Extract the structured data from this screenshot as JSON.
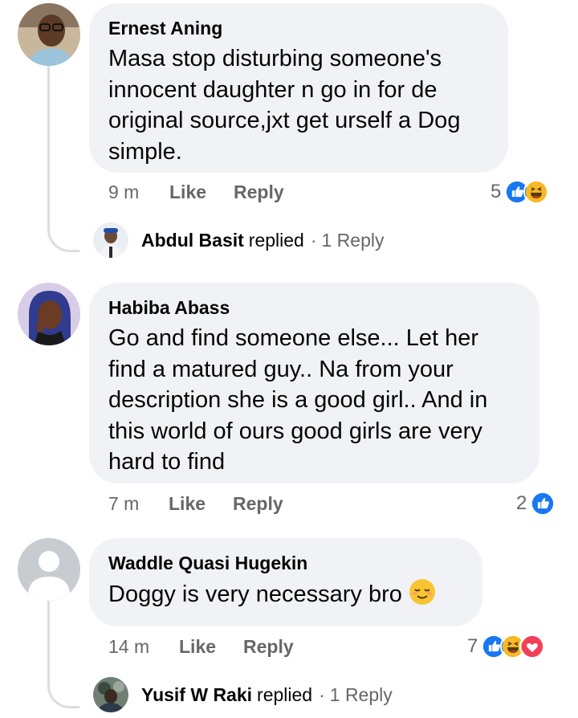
{
  "comments": [
    {
      "author": "Ernest Aning",
      "text": "Masa stop disturbing someone's innocent daughter n go in for de original source,jxt get urself a Dog simple.",
      "time": "9 m",
      "like_label": "Like",
      "reply_label": "Reply",
      "reaction_count": "5",
      "reactions": [
        "like-icon",
        "haha-icon"
      ],
      "replied": {
        "name": "Abdul Basit",
        "verb": "replied",
        "dot": "·",
        "count": "1 Reply"
      }
    },
    {
      "author": "Habiba Abass",
      "text": "Go and find someone else... Let her find a matured guy.. Na from your description she is a good girl.. And in this world of ours good girls are very hard to find",
      "time": "7 m",
      "like_label": "Like",
      "reply_label": "Reply",
      "reaction_count": "2",
      "reactions": [
        "like-icon"
      ]
    },
    {
      "author": "Waddle Quasi Hugekin",
      "text": "Doggy is very necessary bro",
      "text_emoji": "relieved-face-emoji",
      "time": "14 m",
      "like_label": "Like",
      "reply_label": "Reply",
      "reaction_count": "7",
      "reactions": [
        "like-icon",
        "haha-icon",
        "love-icon"
      ],
      "replied": {
        "name": "Yusif W Raki",
        "verb": "replied",
        "dot": "·",
        "count": "1 Reply"
      }
    }
  ],
  "colors": {
    "bubble": "#f0f2f5",
    "meta": "#65676b",
    "like_blue": "#1877f2",
    "love_red": "#f33e58",
    "haha_yellow": "#f7b928"
  }
}
